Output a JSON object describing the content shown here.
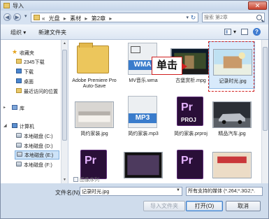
{
  "window": {
    "title": "导入",
    "close_label": "✕"
  },
  "navigation": {
    "back_label": "◀",
    "forward_label": "▶",
    "history_dropdown": "▾",
    "path_prefix": "«",
    "path_segments": [
      "光盘",
      "素材",
      "第2章"
    ],
    "path_separator": "▸",
    "address_dropdown": "▾",
    "refresh_label": "↻",
    "search_placeholder": "搜索 第2章"
  },
  "toolbar": {
    "organize_label": "组织 ▾",
    "new_folder_label": "新建文件夹",
    "view_dropdown": "▾",
    "help_label": "?"
  },
  "sidebar": {
    "favorites_label": "收藏夹",
    "favorites": [
      "2345下载",
      "下载",
      "桌面",
      "最近访问的位置"
    ],
    "library_label": "库",
    "computer_label": "计算机",
    "drives": [
      "本地磁盘 (C:)",
      "本地磁盘 (D:)",
      "本地磁盘 (E:)",
      "本地磁盘 (F:)"
    ],
    "selected_drive_index": 2,
    "expand_glyph": "▸",
    "collapse_glyph": "◢",
    "star_glyph": "★"
  },
  "files": [
    {
      "name": "Adobe Premiere Pro Auto-Save",
      "kind": "folder"
    },
    {
      "name": "MV音乐.wma",
      "kind": "audio",
      "badge": "WMA"
    },
    {
      "name": "古堡赏析.mpg",
      "kind": "video"
    },
    {
      "name": "记录时光.jpg",
      "kind": "image",
      "selected": true
    },
    {
      "name": "简约家装.jpg",
      "kind": "image"
    },
    {
      "name": "简约家装.mp3",
      "kind": "audio",
      "badge": "MP3"
    },
    {
      "name": "简约家装.prproj",
      "kind": "project",
      "badge": "PROJ",
      "logo": "Pr"
    },
    {
      "name": "精品汽车.jpg",
      "kind": "image"
    }
  ],
  "partial_row": [
    {
      "kind": "project",
      "logo": "Pr"
    },
    {
      "kind": "video"
    },
    {
      "kind": "project",
      "logo": "Pr"
    },
    {
      "kind": "image"
    }
  ],
  "annotation": {
    "callout_text": "单击"
  },
  "footer": {
    "image_sequence_label": "图像序列",
    "filename_label": "文件名(N):",
    "filename_value": "记录时光.jpg",
    "filetype_value": "所有支持的媒体 (*.264;*.3G2;*.",
    "import_folder_label": "导入文件夹",
    "open_label": "打开(O)",
    "cancel_label": "取消"
  },
  "colors": {
    "accent": "#3a7ccc",
    "annotation_red": "#d01f1f",
    "premiere_purple": "#2a0f38"
  }
}
